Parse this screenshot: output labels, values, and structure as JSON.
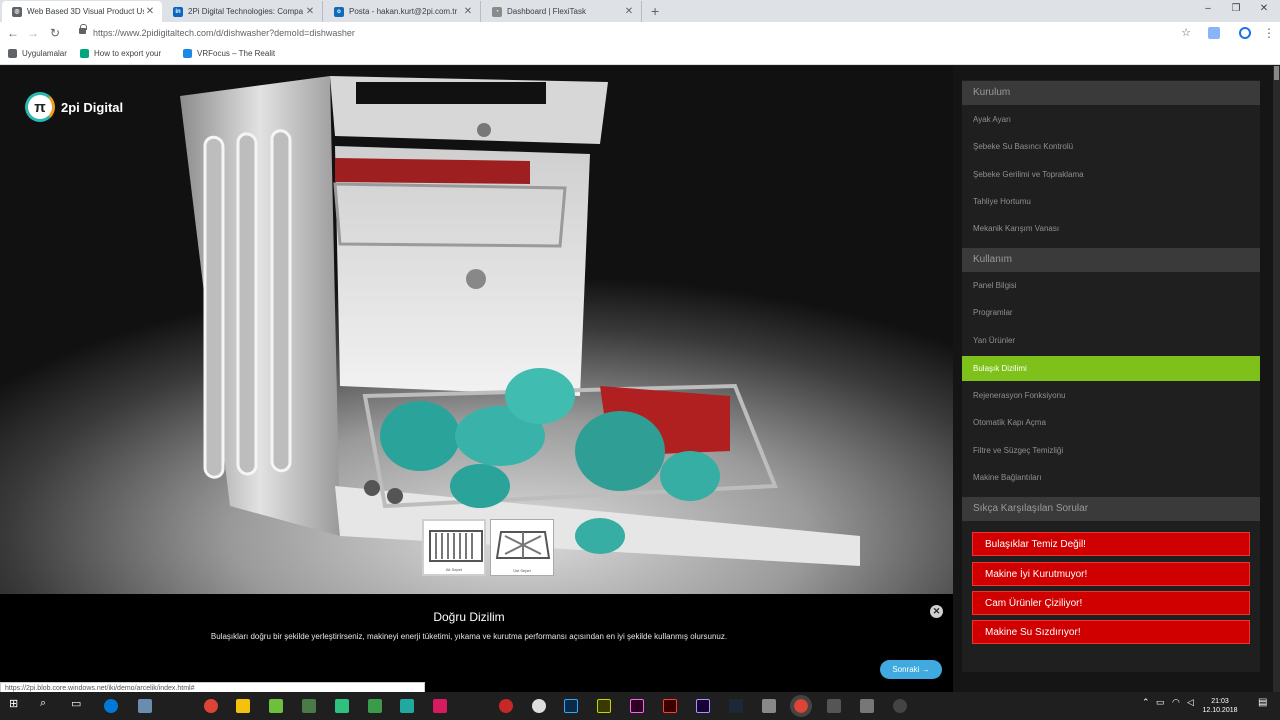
{
  "browser": {
    "tabs": [
      {
        "title": "Web Based 3D Visual Product Us",
        "active": true,
        "icon_color": "#5f6368"
      },
      {
        "title": "2Pi Digital Technologies: Compa",
        "active": false,
        "icon_color": "#0a66c2"
      },
      {
        "title": "Posta - hakan.kurt@2pi.com.tr",
        "active": false,
        "icon_color": "#0f6cbd"
      },
      {
        "title": "Dashboard | FlexiTask",
        "active": false,
        "icon_color": "#8a8a8a"
      }
    ],
    "new_tab": "+",
    "window_controls": {
      "minimize": "–",
      "maximize": "❐",
      "close": "✕"
    },
    "url": "https://www.2pidigitaltech.com/d/dishwasher?demoId=dishwasher",
    "bookmarks": [
      {
        "label": "Uygulamalar",
        "icon_color": "#5f6368"
      },
      {
        "label": "How to export your",
        "icon_color": "#00a67e"
      },
      {
        "label": "VRFocus – The Realit",
        "icon_color": "#1e88e5"
      }
    ]
  },
  "app": {
    "logo_symbol": "π",
    "logo_text": "2pi Digital",
    "thumbnails": [
      {
        "caption": "Alt Sepet",
        "selected": true
      },
      {
        "caption": "Üst Sepet",
        "selected": false
      }
    ],
    "info": {
      "title": "Doğru Dizilim",
      "description": "Bulaşıkları doğru bir şekilde yerleştirirseniz, makineyi enerji tüketimi, yıkama ve kurutma performansı açısından en iyi şekilde kullanmış olursunuz.",
      "close_symbol": "✕",
      "next_label": "Sonraki →"
    },
    "status_url": "https://2pi.blob.core.windows.net/iki/demo/arcelik/index.html#",
    "sidebar": {
      "sections": [
        {
          "title": "Kurulum",
          "items": [
            "Ayak Ayarı",
            "Şebeke Su Basıncı Kontrolü",
            "Şebeke Gerilimi ve Topraklama",
            "Tahliye Hortumu",
            "Mekanik Karışım Vanası"
          ]
        },
        {
          "title": "Kullanım",
          "items": [
            "Panel Bilgisi",
            "Programlar",
            "Yan Ürünler",
            "Bulaşık Dizilimi",
            "Rejenerasyon Fonksiyonu",
            "Otomatik Kapı Açma",
            "Filtre ve Süzgeç Temizliği",
            "Makine Bağlantıları"
          ]
        }
      ],
      "active_item": "Bulaşık Dizilimi",
      "active_color": "#7ec11a",
      "faq": {
        "title": "Sıkça Karşılaşılan Sorular",
        "items": [
          "Bulaşıklar Temiz Değil!",
          "Makine İyi Kurutmuyor!",
          "Cam Ürünler Çiziliyor!",
          "Makine Su Sızdırıyor!"
        ],
        "color": "#d00000"
      }
    }
  },
  "taskbar": {
    "time": "21:03",
    "date": "12.10.2018"
  }
}
